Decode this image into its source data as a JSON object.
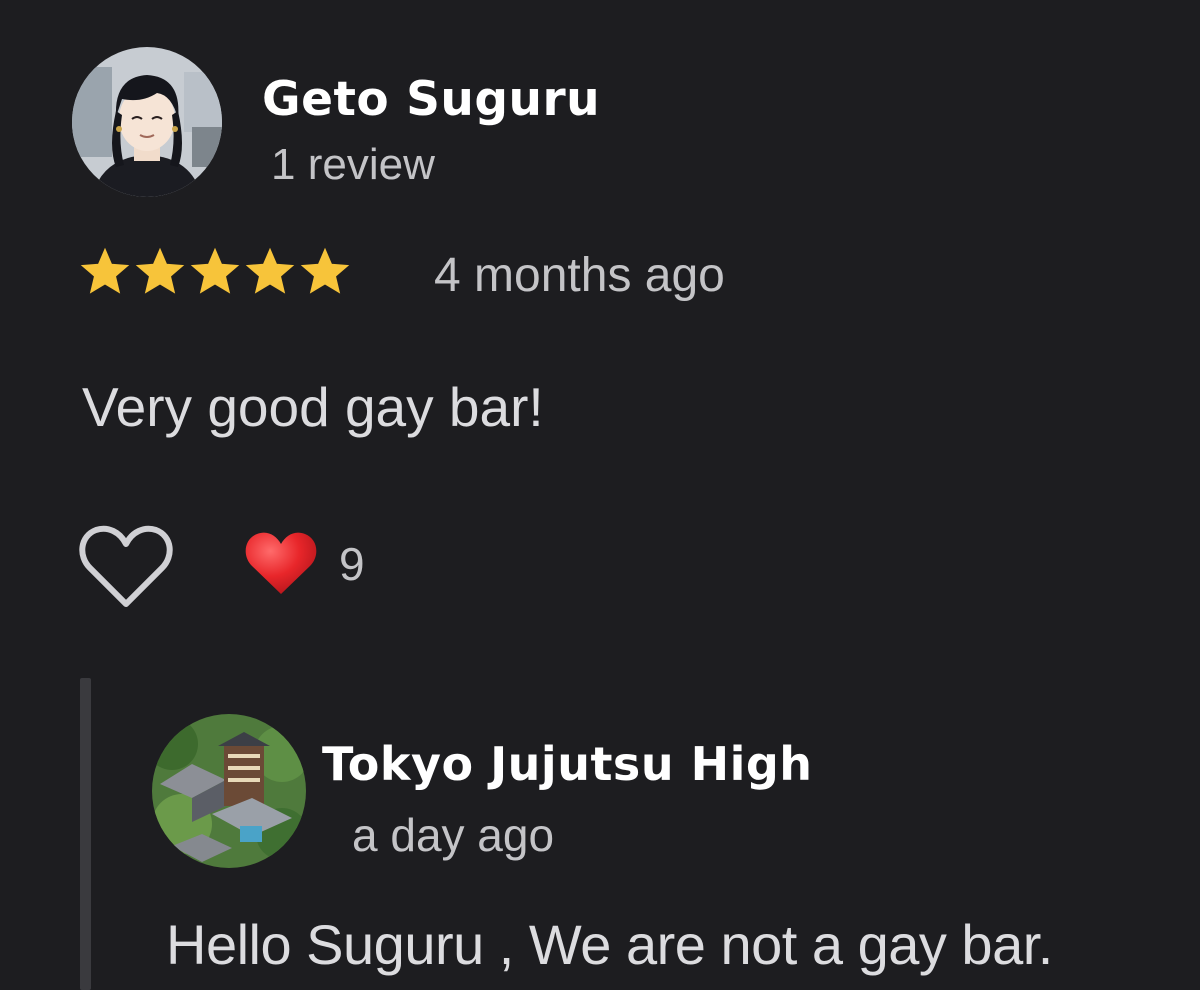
{
  "review": {
    "reviewer_name": "Geto Suguru",
    "review_count": "1 review",
    "rating": 5,
    "rating_max": 5,
    "time": "4 months ago",
    "text": "Very good gay bar!",
    "reaction_emoji": "red-heart",
    "reaction_count": "9",
    "colors": {
      "star": "#f7c43a",
      "heart": "#e8262a"
    }
  },
  "reply": {
    "author_name": "Tokyo Jujutsu High",
    "time": "a day ago",
    "text": "Hello Suguru , We are not a gay bar."
  }
}
